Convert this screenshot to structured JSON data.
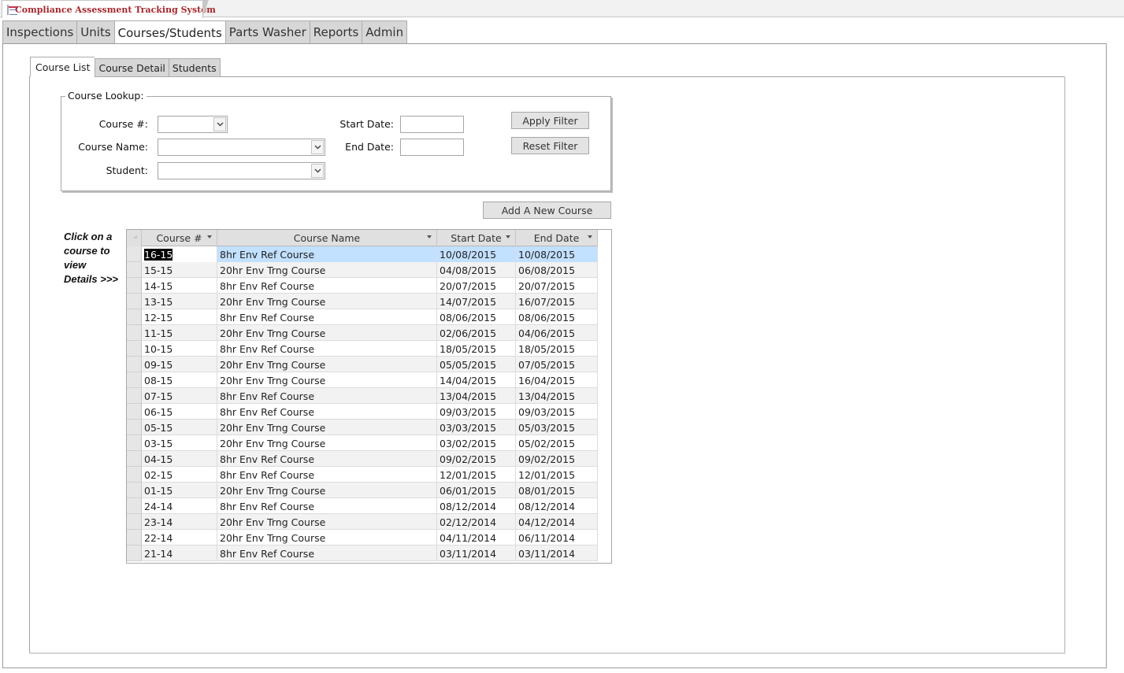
{
  "window": {
    "title": "Compliance Assessment Tracking System"
  },
  "main_tabs": [
    "Inspections",
    "Units",
    "Courses/Students",
    "Parts Washer",
    "Reports",
    "Admin"
  ],
  "active_main_tab": "Courses/Students",
  "sub_tabs": [
    "Course List",
    "Course Detail",
    "Students"
  ],
  "active_sub_tab": "Course List",
  "lookup": {
    "legend": "Course Lookup:",
    "course_num_label": "Course #:",
    "course_num_value": "",
    "course_name_label": "Course Name:",
    "course_name_value": "",
    "student_label": "Student:",
    "student_value": "",
    "start_date_label": "Start Date:",
    "start_date_value": "",
    "end_date_label": "End Date:",
    "end_date_value": "",
    "apply_filter": "Apply Filter",
    "reset_filter": "Reset Filter"
  },
  "add_course_button": "Add A New Course",
  "note": [
    "Click on a",
    "course to",
    "view",
    "Details >>>"
  ],
  "table": {
    "columns": [
      "Course #",
      "Course Name",
      "Start Date",
      "End Date"
    ],
    "selected_row": 0,
    "rows": [
      [
        "16-15",
        "8hr Env Ref Course",
        "10/08/2015",
        "10/08/2015"
      ],
      [
        "15-15",
        "20hr Env Trng Course",
        "04/08/2015",
        "06/08/2015"
      ],
      [
        "14-15",
        "8hr Env Ref Course",
        "20/07/2015",
        "20/07/2015"
      ],
      [
        "13-15",
        "20hr Env Trng Course",
        "14/07/2015",
        "16/07/2015"
      ],
      [
        "12-15",
        "8hr Env Ref Course",
        "08/06/2015",
        "08/06/2015"
      ],
      [
        "11-15",
        "20hr Env Trng Course",
        "02/06/2015",
        "04/06/2015"
      ],
      [
        "10-15",
        "8hr Env Ref Course",
        "18/05/2015",
        "18/05/2015"
      ],
      [
        "09-15",
        "20hr Env Trng Course",
        "05/05/2015",
        "07/05/2015"
      ],
      [
        "08-15",
        "20hr Env Trng Course",
        "14/04/2015",
        "16/04/2015"
      ],
      [
        "07-15",
        "8hr Env Ref Course",
        "13/04/2015",
        "13/04/2015"
      ],
      [
        "06-15",
        "8hr Env Ref Course",
        "09/03/2015",
        "09/03/2015"
      ],
      [
        "05-15",
        "20hr Env Trng Course",
        "03/03/2015",
        "05/03/2015"
      ],
      [
        "03-15",
        "20hr Env Trng Course",
        "03/02/2015",
        "05/02/2015"
      ],
      [
        "04-15",
        "8hr Env Ref Course",
        "09/02/2015",
        "09/02/2015"
      ],
      [
        "02-15",
        "8hr Env Ref Course",
        "12/01/2015",
        "12/01/2015"
      ],
      [
        "01-15",
        "20hr Env Trng Course",
        "06/01/2015",
        "08/01/2015"
      ],
      [
        "24-14",
        "8hr Env Ref Course",
        "08/12/2014",
        "08/12/2014"
      ],
      [
        "23-14",
        "20hr Env Trng Course",
        "02/12/2014",
        "04/12/2014"
      ],
      [
        "22-14",
        "20hr Env Trng Course",
        "04/11/2014",
        "06/11/2014"
      ],
      [
        "21-14",
        "8hr Env Ref Course",
        "03/11/2014",
        "03/11/2014"
      ]
    ]
  }
}
